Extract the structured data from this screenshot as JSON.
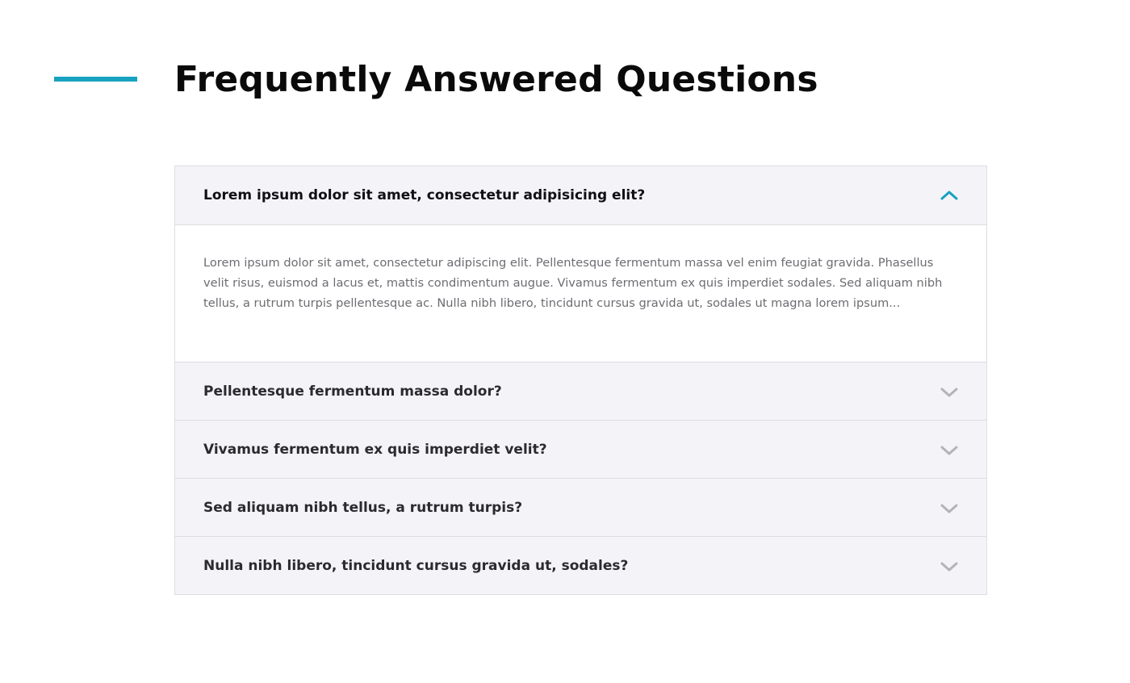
{
  "page": {
    "title": "Frequently Answered Questions",
    "accent_color": "#17a2c0"
  },
  "faq": {
    "items": [
      {
        "question": "Lorem ipsum dolor sit amet, consectetur adipisicing elit?",
        "answer": "Lorem ipsum dolor sit amet, consectetur adipiscing elit. Pellentesque fermentum massa vel enim feugiat gravida. Phasellus velit risus, euismod a lacus et, mattis condimentum augue. Vivamus fermentum ex quis imperdiet sodales. Sed aliquam nibh tellus, a rutrum turpis pellentesque ac. Nulla nibh libero, tincidunt cursus gravida ut, sodales ut magna lorem ipsum...",
        "expanded": true,
        "icon": "chevron-up-icon"
      },
      {
        "question": "Pellentesque fermentum massa dolor?",
        "expanded": false,
        "icon": "chevron-down-icon"
      },
      {
        "question": "Vivamus fermentum ex quis imperdiet velit?",
        "expanded": false,
        "icon": "chevron-down-icon"
      },
      {
        "question": "Sed aliquam nibh tellus, a rutrum turpis?",
        "expanded": false,
        "icon": "chevron-down-icon"
      },
      {
        "question": "Nulla nibh libero, tincidunt cursus gravida ut, sodales?",
        "expanded": false,
        "icon": "chevron-down-icon"
      }
    ],
    "colors": {
      "icon_expanded": "#17a2c0",
      "icon_collapsed": "#b4b4b8"
    }
  }
}
